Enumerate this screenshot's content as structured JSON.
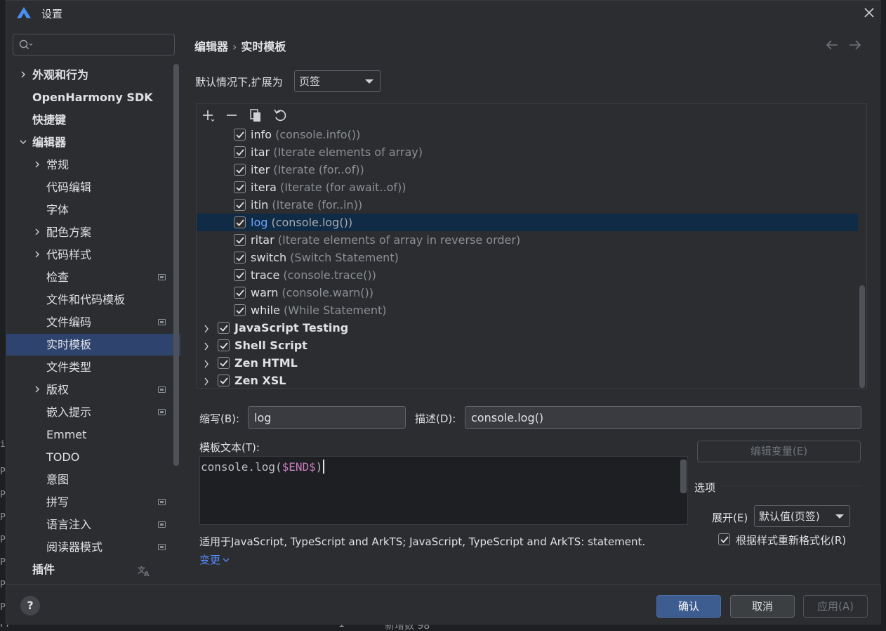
{
  "background": {
    "left_letters": [
      "i",
      "P",
      "P",
      "P",
      "P",
      "P",
      "P",
      "P",
      "P",
      "P"
    ],
    "bottom_text": [
      "PP",
      "1",
      "新增数 98"
    ]
  },
  "dialog": {
    "title": "设置"
  },
  "sidebar": {
    "search_placeholder": "",
    "items": [
      {
        "label": "外观和行为"
      },
      {
        "label": "OpenHarmony SDK"
      },
      {
        "label": "快捷键"
      },
      {
        "label": "编辑器"
      },
      {
        "label": "常规"
      },
      {
        "label": "代码编辑"
      },
      {
        "label": "字体"
      },
      {
        "label": "配色方案"
      },
      {
        "label": "代码样式"
      },
      {
        "label": "检查"
      },
      {
        "label": "文件和代码模板"
      },
      {
        "label": "文件编码"
      },
      {
        "label": "实时模板"
      },
      {
        "label": "文件类型"
      },
      {
        "label": "版权"
      },
      {
        "label": "嵌入提示"
      },
      {
        "label": "Emmet"
      },
      {
        "label": "TODO"
      },
      {
        "label": "意图"
      },
      {
        "label": "拼写"
      },
      {
        "label": "语言注入"
      },
      {
        "label": "阅读器模式"
      },
      {
        "label": "插件"
      }
    ]
  },
  "breadcrumb": {
    "parent": "编辑器",
    "separator": "›",
    "current": "实时模板"
  },
  "expand_default": {
    "label": "默认情况下,扩展为",
    "value": "页签"
  },
  "templates": {
    "rows": [
      {
        "name": "info",
        "desc": " (console.info())"
      },
      {
        "name": "itar",
        "desc": " (Iterate elements of array)"
      },
      {
        "name": "iter",
        "desc": " (Iterate (for..of))"
      },
      {
        "name": "itera",
        "desc": " (Iterate (for await..of))"
      },
      {
        "name": "itin",
        "desc": " (Iterate (for..in))"
      },
      {
        "name": "log",
        "desc": " (console.log())"
      },
      {
        "name": "ritar",
        "desc": " (Iterate elements of array in reverse order)"
      },
      {
        "name": "switch",
        "desc": " (Switch Statement)"
      },
      {
        "name": "trace",
        "desc": " (console.trace())"
      },
      {
        "name": "warn",
        "desc": " (console.warn())"
      },
      {
        "name": "while",
        "desc": " (While Statement)"
      }
    ],
    "groups": [
      {
        "name": "JavaScript Testing"
      },
      {
        "name": "Shell Script"
      },
      {
        "name": "Zen HTML"
      },
      {
        "name": "Zen XSL"
      }
    ],
    "selected": "log"
  },
  "editor": {
    "abbr_label": "缩写(B):",
    "abbr_value": "log",
    "desc_label": "描述(D):",
    "desc_value": "console.log()",
    "template_label": "模板文本(T):",
    "code_before": "console.log(",
    "code_var": "$END$",
    "code_after": ")",
    "edit_vars_label": "编辑变量(E)",
    "options_label": "选项",
    "expand_label": "展开(E)",
    "expand_value": "默认值(页签)",
    "reformat_label": "根据样式重新格式化(R)",
    "applicable": "适用于JavaScript, TypeScript and ArkTS; JavaScript, TypeScript and ArkTS: statement.",
    "change_link": "变更"
  },
  "footer": {
    "help": "?",
    "ok": "确认",
    "cancel": "取消",
    "apply": "应用(A)"
  },
  "colors": {
    "accent": "#3574f0",
    "selection_sidebar": "#2e436e",
    "selection_list": "#0f2b45",
    "link": "#548af7",
    "template_var": "#c77dbb"
  }
}
